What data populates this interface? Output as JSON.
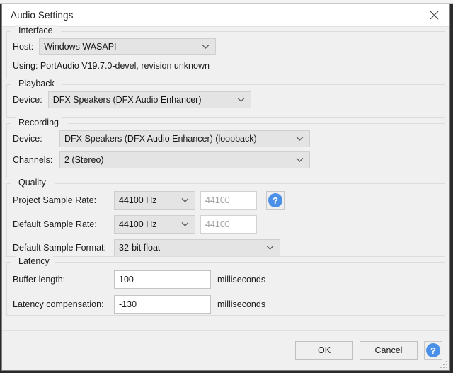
{
  "window": {
    "title": "Audio Settings",
    "close_icon": "close-icon"
  },
  "groups": {
    "interface": {
      "title": "Interface",
      "host_label": "Host:",
      "host_value": "Windows WASAPI",
      "using_text": "Using: PortAudio V19.7.0-devel, revision unknown"
    },
    "playback": {
      "title": "Playback",
      "device_label": "Device:",
      "device_value": "DFX Speakers (DFX Audio Enhancer)"
    },
    "recording": {
      "title": "Recording",
      "device_label": "Device:",
      "device_value": "DFX Speakers (DFX Audio Enhancer) (loopback)",
      "channels_label": "Channels:",
      "channels_value": "2 (Stereo)"
    },
    "quality": {
      "title": "Quality",
      "project_rate_label": "Project Sample Rate:",
      "project_rate_value": "44100 Hz",
      "project_rate_field": "44100",
      "default_rate_label": "Default Sample Rate:",
      "default_rate_value": "44100 Hz",
      "default_rate_field": "44100",
      "format_label": "Default Sample Format:",
      "format_value": "32-bit float",
      "help_icon": "?"
    },
    "latency": {
      "title": "Latency",
      "buffer_label": "Buffer length:",
      "buffer_value": "100",
      "buffer_unit": "milliseconds",
      "compensation_label": "Latency compensation:",
      "compensation_value": "-130",
      "compensation_unit": "milliseconds"
    }
  },
  "footer": {
    "ok_label": "OK",
    "cancel_label": "Cancel",
    "help_icon": "?"
  },
  "colors": {
    "accent_blue": "#4a90e8",
    "dialog_bg": "#f0f0f0",
    "combo_bg": "#e4e4e4"
  }
}
